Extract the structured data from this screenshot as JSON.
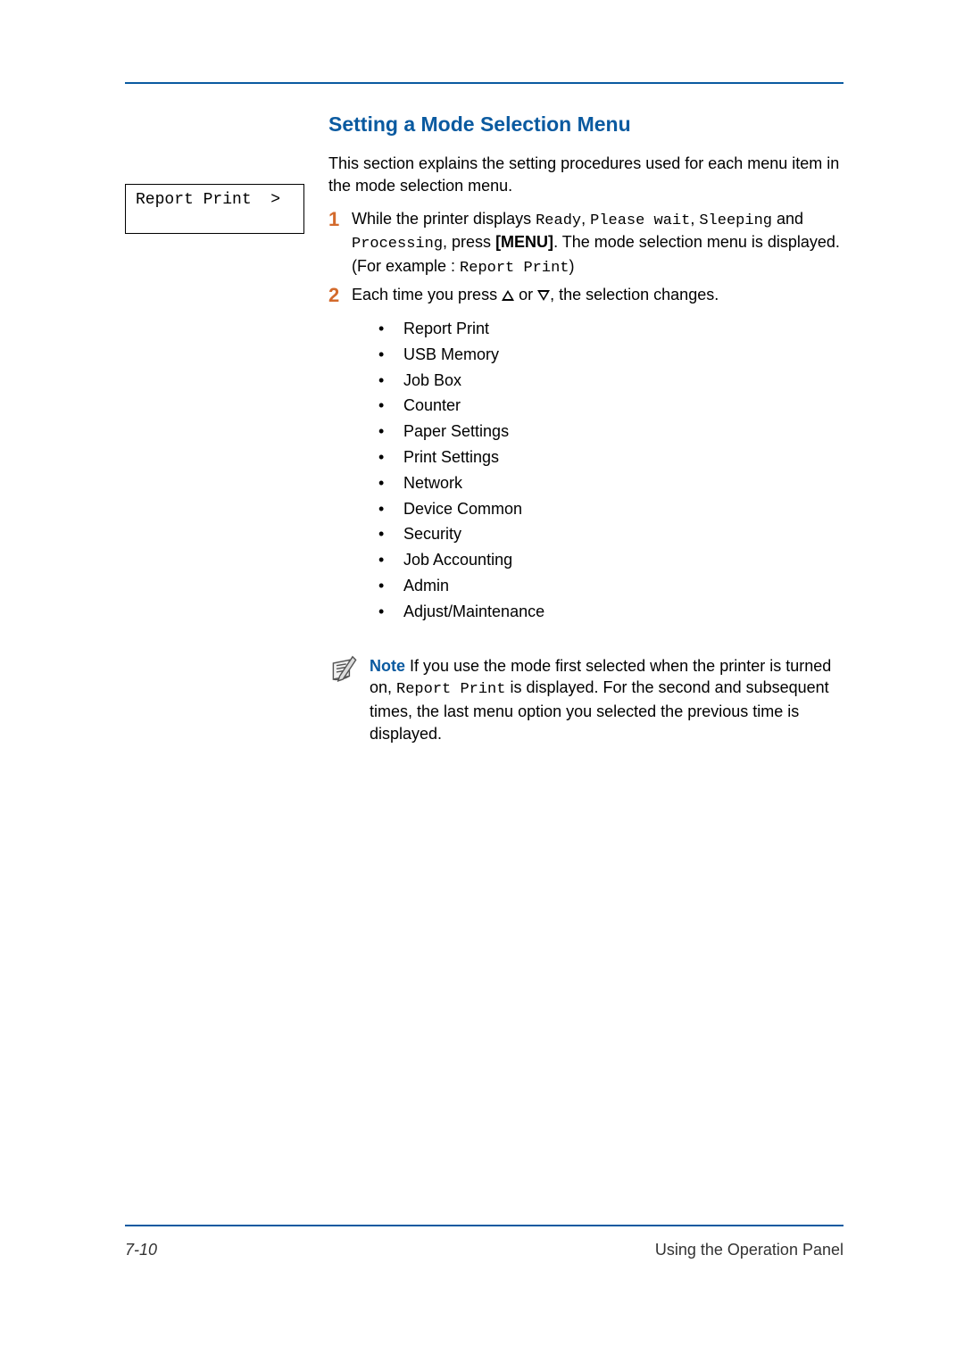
{
  "footer": {
    "page_number": "7-10",
    "chapter": "Using the Operation Panel"
  },
  "lcd": {
    "text": "Report Print  >"
  },
  "section": {
    "title": "Setting a Mode Selection Menu",
    "intro": "This section explains the setting procedures used for each menu item in the mode selection menu."
  },
  "step1": {
    "num": "1",
    "t1": "While the printer displays ",
    "m1": "Ready",
    "t2": ", ",
    "m2": "Please wait",
    "t3": ", ",
    "m3": "Sleeping",
    "t4": " and ",
    "m4": "Processing",
    "t5": ", press ",
    "b1": "[MENU]",
    "t6": ". The mode selection menu is displayed. (For example : ",
    "m5": "Report Print",
    "t7": ")"
  },
  "step2": {
    "num": "2",
    "t1": "Each time you press ",
    "t2": " or ",
    "t3": ", the selection changes."
  },
  "menu_items": [
    "Report Print",
    "USB Memory",
    "Job Box",
    "Counter",
    "Paper Settings",
    "Print Settings",
    "Network",
    "Device Common",
    "Security",
    "Job Accounting",
    "Admin",
    "Adjust/Maintenance"
  ],
  "note": {
    "label": "Note",
    "t1": "  If you use the mode first selected when the printer is turned on, ",
    "m1": "Report Print",
    "t2": " is displayed. For the second and subsequent times, the last menu option you selected the previous time is displayed."
  }
}
